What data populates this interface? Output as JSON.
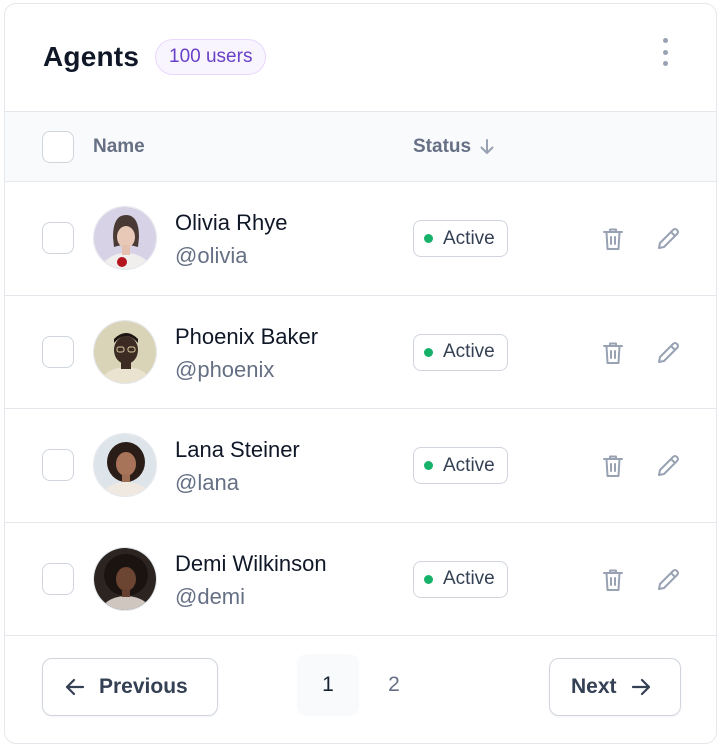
{
  "header": {
    "title": "Agents",
    "badge": "100 users",
    "menu_icon": "dots-vertical-icon"
  },
  "table": {
    "columns": {
      "name": "Name",
      "status": "Status"
    },
    "sort_icon": "arrow-down-icon",
    "rows": [
      {
        "name": "Olivia Rhye",
        "handle": "@olivia",
        "status": "Active"
      },
      {
        "name": "Phoenix Baker",
        "handle": "@phoenix",
        "status": "Active"
      },
      {
        "name": "Lana Steiner",
        "handle": "@lana",
        "status": "Active"
      },
      {
        "name": "Demi Wilkinson",
        "handle": "@demi",
        "status": "Active"
      }
    ]
  },
  "pagination": {
    "previous": "Previous",
    "next": "Next",
    "pages": [
      "1",
      "2"
    ],
    "current": "1"
  },
  "colors": {
    "accent": "#6941c6",
    "badge_bg": "#f9f5ff",
    "status_dot": "#17b26a",
    "border": "#e4e7ec"
  }
}
